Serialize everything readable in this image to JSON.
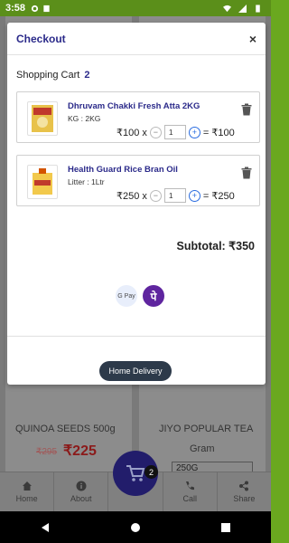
{
  "status_bar": {
    "time": "3:58"
  },
  "background": {
    "product_left": {
      "name": "QUINOA SEEDS 500g",
      "old_price": "₹295",
      "price": "₹225"
    },
    "product_right": {
      "name": "JIYO POPULAR TEA",
      "unit": "Gram",
      "select_value": "250G"
    },
    "nav": {
      "home": "Home",
      "about": "About",
      "call": "Call",
      "share": "Share"
    },
    "cart_badge": "2"
  },
  "modal": {
    "title": "Checkout",
    "close": "×",
    "cart_label": "Shopping Cart",
    "cart_count": "2",
    "items": [
      {
        "name": "Dhruvam Chakki Fresh Atta 2KG",
        "variant": "KG : 2KG",
        "price": "₹100 x",
        "qty": "1",
        "total": "= ₹100"
      },
      {
        "name": "Health Guard Rice Bran Oil",
        "variant": "Litter : 1Ltr",
        "price": "₹250 x",
        "qty": "1",
        "total": "= ₹250"
      }
    ],
    "subtotal": "Subtotal: ₹350",
    "gpay_label": "G Pay",
    "phonepe_label": "पे",
    "delivery_button": "Home Delivery"
  },
  "colors": {
    "brand": "#2b2a8a",
    "status_green": "#6aa81f",
    "button_dark": "#2d3a4a"
  }
}
